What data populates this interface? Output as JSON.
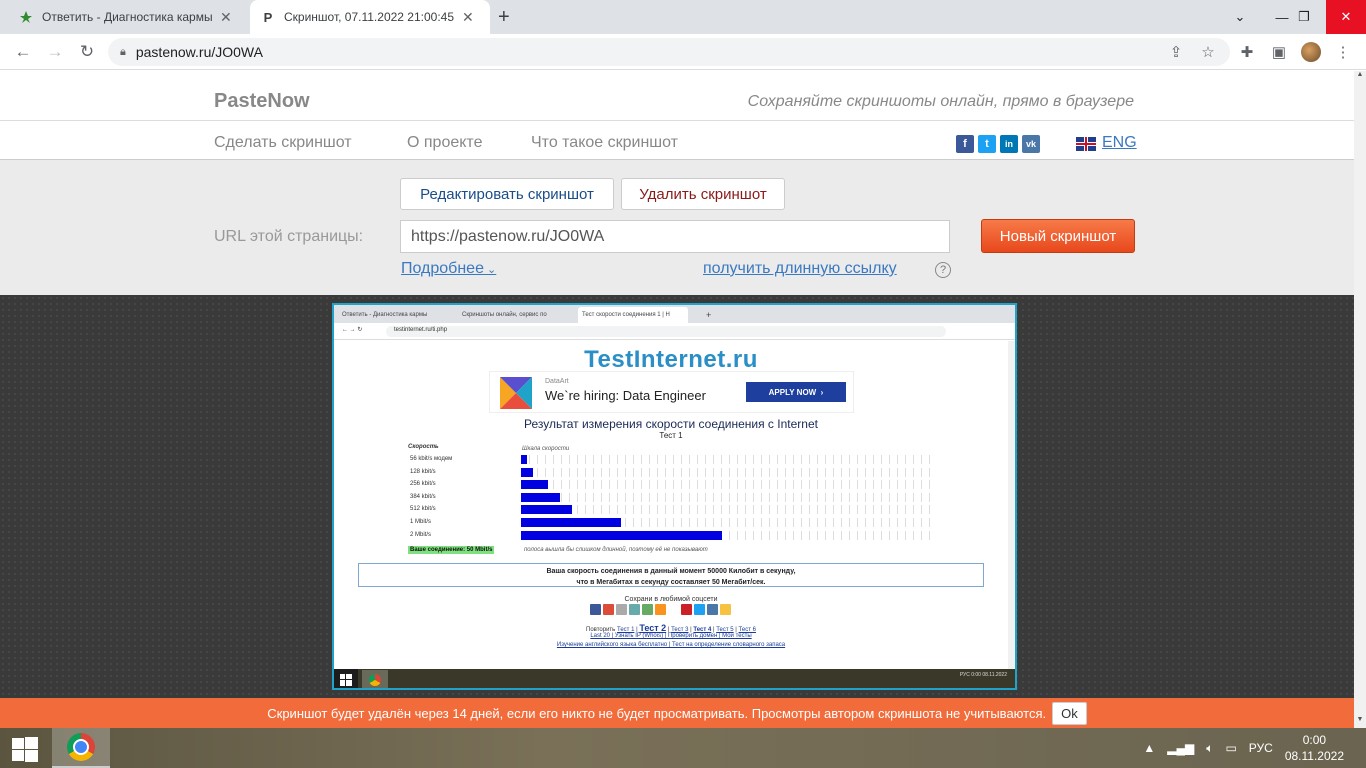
{
  "browser": {
    "tabs": [
      {
        "title": "Ответить - Диагностика кармы",
        "icon": "leaf-icon",
        "active": false
      },
      {
        "title": "Скриншот, 07.11.2022 21:00:45",
        "icon": "pastenow-p-icon",
        "favicon_letter": "P",
        "active": true
      }
    ],
    "url": "pastenow.ru/JO0WA"
  },
  "site": {
    "logo": "PasteNow",
    "tagline": "Сохраняйте скриншоты онлайн, прямо в браузере",
    "nav": [
      "Сделать скриншот",
      "О проекте",
      "Что такое скриншот"
    ],
    "social": [
      {
        "name": "facebook",
        "letter": "f",
        "color": "#3b5998"
      },
      {
        "name": "twitter",
        "letter": "t",
        "color": "#1da1f2"
      },
      {
        "name": "linkedin",
        "letter": "in",
        "color": "#0077b5"
      },
      {
        "name": "vk",
        "letter": "vk",
        "color": "#4a76a8"
      }
    ],
    "lang": "ENG"
  },
  "controls": {
    "edit_btn": "Редактировать скриншот",
    "delete_btn": "Удалить скриншот",
    "url_label": "URL этой страницы:",
    "url_value": "https://pastenow.ru/JO0WA",
    "new_btn": "Новый скриншот",
    "more_link": "Подробнее",
    "long_link": "получить длинную ссылку",
    "help": "?"
  },
  "screenshot": {
    "tabs": [
      "Ответить - Диагностика кармы",
      "Скриншоты онлайн, сервис по",
      "Тест скорости соединения 1 | Н"
    ],
    "url": "testinternet.ru/ti.php",
    "logo": "TestInternet.ru",
    "ad": {
      "brand": "DataArt",
      "headline": "We`re hiring: Data Engineer",
      "button": "APPLY NOW"
    },
    "result_title": "Результат измерения скорости соединения с Internet",
    "test_label": "Тест 1",
    "speed_head": "Скорость",
    "scale_head": "Шкала скорости",
    "rows": [
      {
        "label": "56 kbit/s модем",
        "level": 0.015
      },
      {
        "label": "128 kbit/s",
        "level": 0.03
      },
      {
        "label": "256 kbit/s",
        "level": 0.065
      },
      {
        "label": "384 kbit/s",
        "level": 0.095
      },
      {
        "label": "512 kbit/s",
        "level": 0.125
      },
      {
        "label": "1 Mbit/s",
        "level": 0.245
      },
      {
        "label": "2 Mbit/s",
        "level": 0.49
      }
    ],
    "your_conn": "Ваше соединение: 50 Mbit/s",
    "too_long": "полоса вышла бы слишком длинной, поэтому её не показывают",
    "result_line1": "Ваша скорость соединения в данный момент 50000 Килобит в секунду,",
    "result_line2": "что в Мегабитах в секунду составляет 50 Мегабит/сек.",
    "save_social": "Сохрани в любимой соцсети",
    "repeat_label": "Повторить",
    "tests": [
      "Тест 1",
      "Тест 2",
      "Тест 3",
      "Тест 4",
      "Тест 5",
      "Тест 6"
    ],
    "links2": "Last 20 | Узнать IP (Whois) | Проверить домен | Мои тесты",
    "links3": "Изучение английского языка бесплатно | Тест на определение словарного запаса",
    "tray_lang": "РУС",
    "tray_time": "0:00",
    "tray_date": "08.11.2022"
  },
  "notice": {
    "text": "Скриншот будет удалён через 14 дней, если его никто не будет просматривать. Просмотры автором скриншота не учитываются.",
    "ok": "Ok"
  },
  "taskbar": {
    "lang": "РУС",
    "time": "0:00",
    "date": "08.11.2022"
  }
}
